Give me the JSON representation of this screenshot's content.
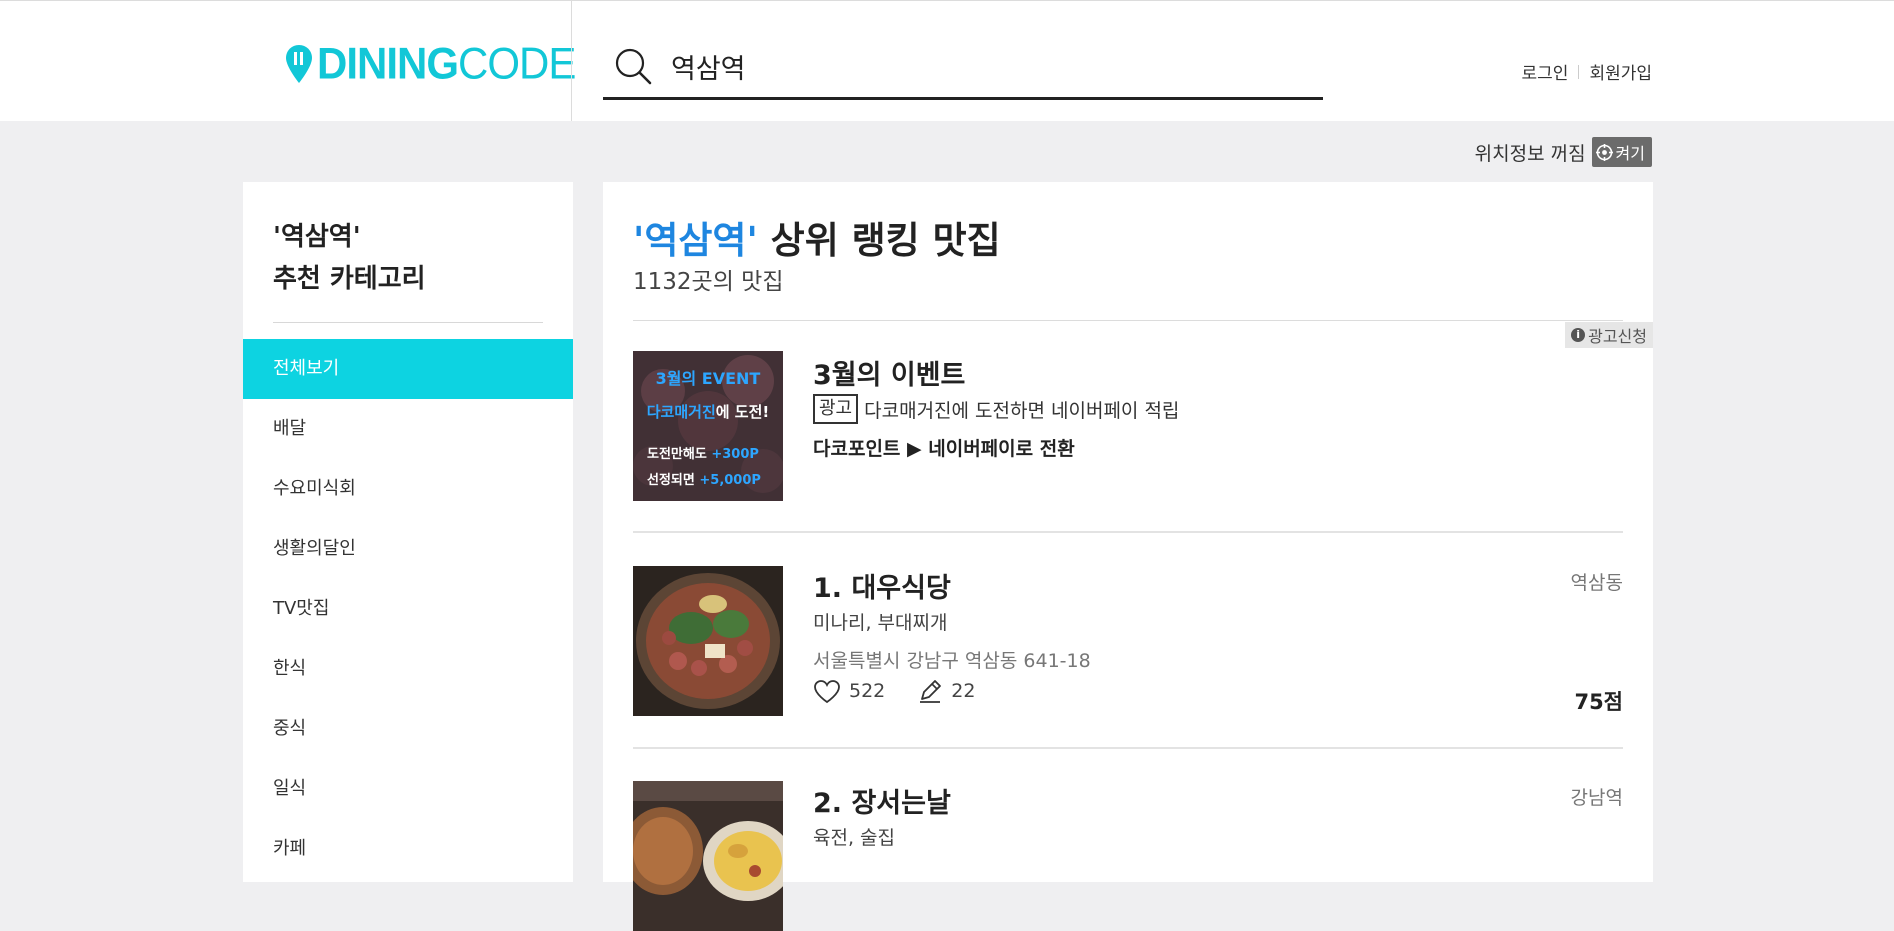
{
  "header": {
    "logo_text_bold": "DINING",
    "logo_text_light": "CODE",
    "search_value": "역삼역",
    "login": "로그인",
    "signup": "회원가입"
  },
  "location": {
    "status": "위치정보 꺼짐",
    "toggle_label": "켜기"
  },
  "sidebar": {
    "title_line1": "'역삼역'",
    "title_line2": "추천 카테고리",
    "items": [
      {
        "label": "전체보기",
        "active": true
      },
      {
        "label": "배달"
      },
      {
        "label": "수요미식회"
      },
      {
        "label": "생활의달인"
      },
      {
        "label": "TV맛집"
      },
      {
        "label": "한식"
      },
      {
        "label": "중식"
      },
      {
        "label": "일식"
      },
      {
        "label": "카페"
      }
    ]
  },
  "main": {
    "title_query": "'역삼역'",
    "title_rest": " 상위 랭킹 맛집",
    "subtitle": "1132곳의 맛집",
    "ad_apply": "광고신청",
    "ad": {
      "image_line1": "3월의 EVENT",
      "image_line2_highlight": "다코매거진",
      "image_line2_rest": "에 도전!",
      "image_line3": "도전만해도",
      "image_line3_points": "+300P",
      "image_line4": "선정되면",
      "image_line4_points": "+5,000P",
      "title": "3월의 이벤트",
      "badge": "광고",
      "desc": "다코매거진에 도전하면 네이버페이 적립",
      "bold": "다코포인트 ▶ 네이버페이로 전환"
    },
    "restaurants": [
      {
        "name": "1. 대우식당",
        "category": "미나리, 부대찌개",
        "address": "서울특별시 강남구 역삼동 641-18",
        "area": "역삼동",
        "likes": "522",
        "reviews": "22",
        "score": "75점"
      },
      {
        "name": "2. 장서는날",
        "category": "육전, 술집",
        "area": "강남역"
      }
    ]
  },
  "colors": {
    "brand": "#12c7d7",
    "active_menu": "#0dd3e1",
    "query_highlight": "#1e86e0",
    "page_bg": "#efeff1"
  }
}
